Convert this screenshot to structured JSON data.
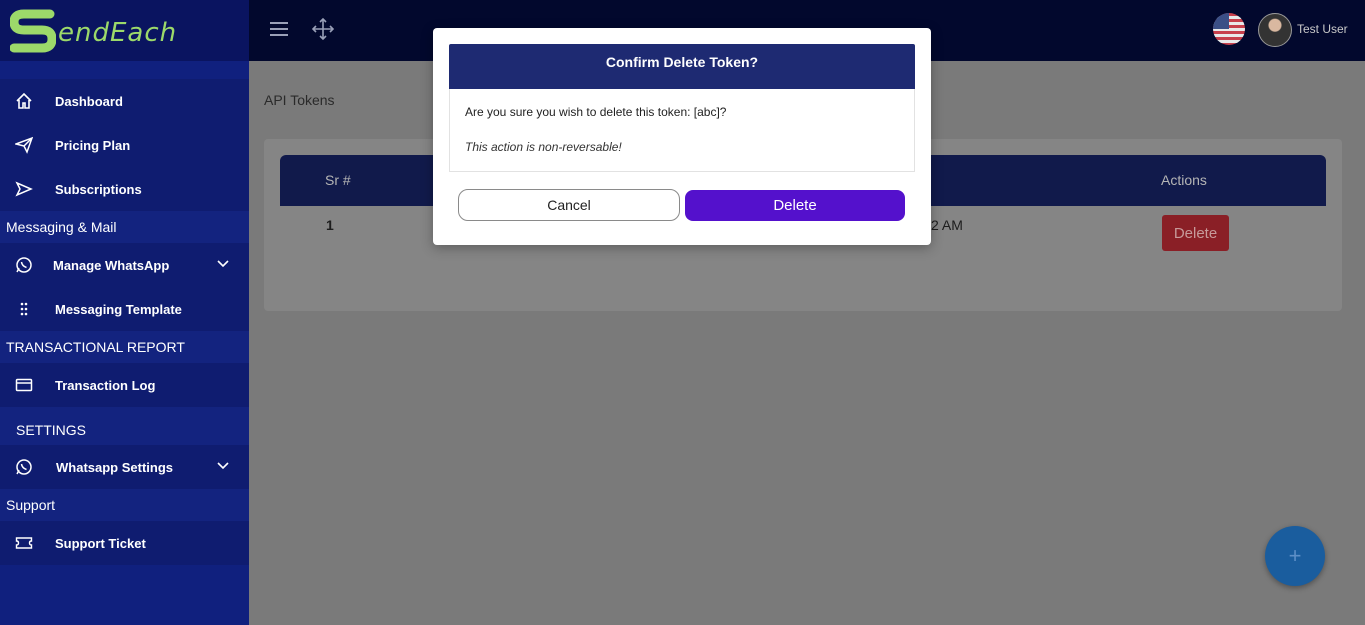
{
  "brand": {
    "logo_text": "endEach"
  },
  "sidebar": {
    "items": [
      {
        "label": "Dashboard",
        "icon": "home-icon"
      },
      {
        "label": "Pricing Plan",
        "icon": "paper-plane-icon"
      },
      {
        "label": "Subscriptions",
        "icon": "send-icon"
      }
    ],
    "section_messaging": "Messaging & Mail",
    "messaging_items": [
      {
        "label": "Manage WhatsApp",
        "icon": "whatsapp-icon"
      },
      {
        "label": "Messaging Template",
        "icon": "grip-icon"
      }
    ],
    "section_report": "TRANSACTIONAL REPORT",
    "report_items": [
      {
        "label": "Transaction Log",
        "icon": "credit-card-icon"
      }
    ],
    "section_settings": "SETTINGS",
    "settings_items": [
      {
        "label": "Whatsapp Settings",
        "icon": "whatsapp-icon"
      }
    ],
    "section_support": "Support",
    "support_items": [
      {
        "label": "Support Ticket",
        "icon": "ticket-icon"
      }
    ]
  },
  "topbar": {
    "user_name": "Test User"
  },
  "page": {
    "title": "API Tokens"
  },
  "table": {
    "headers": [
      "Sr #",
      "Actions"
    ],
    "rows": [
      {
        "sr": "1",
        "time_fragment": "2 AM",
        "action": "Delete"
      }
    ]
  },
  "fab": {
    "label": "+"
  },
  "modal": {
    "title": "Confirm Delete Token?",
    "question": "Are you sure you wish to delete this token: [abc]?",
    "warning": "This action is non-reversable!",
    "cancel_label": "Cancel",
    "delete_label": "Delete"
  }
}
